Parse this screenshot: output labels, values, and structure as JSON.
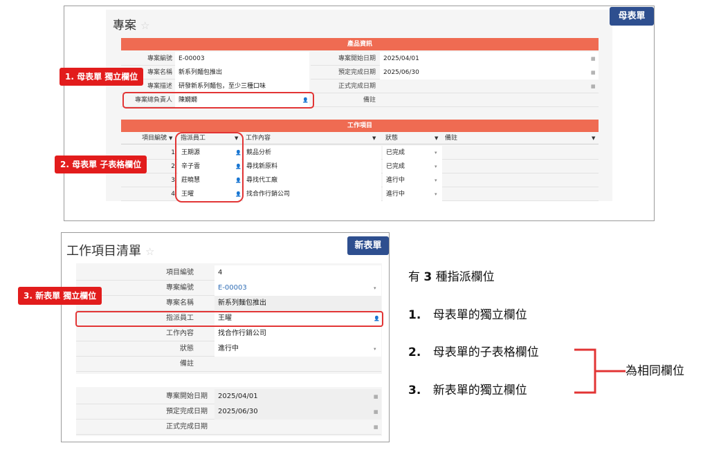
{
  "parent_form": {
    "title": "專案",
    "badge": "母表單",
    "section_product": "產品資訊",
    "fields": [
      {
        "label": "專案編號",
        "value": "E-00003"
      },
      {
        "label": "專案名稱",
        "value": "新系列麵包推出"
      },
      {
        "label": "專案描述",
        "value": "研發新系列麵包，至少三種口味"
      },
      {
        "label": "專案總負責人",
        "value": "陳嫺嫺"
      }
    ],
    "right_fields": [
      {
        "label": "專案開始日期",
        "value": "2025/04/01"
      },
      {
        "label": "預定完成日期",
        "value": "2025/06/30"
      },
      {
        "label": "正式完成日期",
        "value": ""
      },
      {
        "label": "備註",
        "value": ""
      }
    ],
    "section_work": "工作項目",
    "table_headers": [
      "項目編號",
      "指派員工",
      "工作內容",
      "狀態",
      "備註"
    ],
    "rows": [
      {
        "no": "1",
        "employee": "王期源",
        "content": "競品分析",
        "status": "已完成"
      },
      {
        "no": "2",
        "employee": "辛子雲",
        "content": "尋找新原料",
        "status": "已完成"
      },
      {
        "no": "3",
        "employee": "莊曉慧",
        "content": "尋找代工廠",
        "status": "進行中"
      },
      {
        "no": "4",
        "employee": "王曜",
        "content": "找合作行銷公司",
        "status": "進行中"
      }
    ]
  },
  "new_form": {
    "title": "工作項目清單",
    "badge": "新表單",
    "fields": [
      {
        "label": "項目編號",
        "value": "4"
      },
      {
        "label": "專案編號",
        "value": "E-00003"
      },
      {
        "label": "專案名稱",
        "value": "新系列麵包推出"
      },
      {
        "label": "指派員工",
        "value": "王曜"
      },
      {
        "label": "工作內容",
        "value": "找合作行銷公司"
      },
      {
        "label": "狀態",
        "value": "進行中"
      },
      {
        "label": "備註",
        "value": ""
      }
    ],
    "date_fields": [
      {
        "label": "專案開始日期",
        "value": "2025/04/01"
      },
      {
        "label": "預定完成日期",
        "value": "2025/06/30"
      },
      {
        "label": "正式完成日期",
        "value": ""
      }
    ]
  },
  "callouts": {
    "c1": "1. 母表單 獨立欄位",
    "c2": "2. 母表單 子表格欄位",
    "c3": "3. 新表單 獨立欄位"
  },
  "notes": {
    "heading_pre": "有",
    "heading_num": "3",
    "heading_post": "種指派欄位",
    "item1_num": "1.",
    "item1": "母表單的獨立欄位",
    "item2_num": "2.",
    "item2": "母表單的子表格欄位",
    "item3_num": "3.",
    "item3": "新表單的獨立欄位",
    "conclusion": "為相同欄位"
  },
  "icons": {
    "calendar": "calendar-icon",
    "person": "person-icon",
    "dropdown": "chevron-down-icon",
    "star": "star-icon"
  },
  "colors": {
    "accent_band": "#ef6b52",
    "badge": "#2e4f8f",
    "callout": "#e21c1c",
    "link": "#2f6db5"
  }
}
